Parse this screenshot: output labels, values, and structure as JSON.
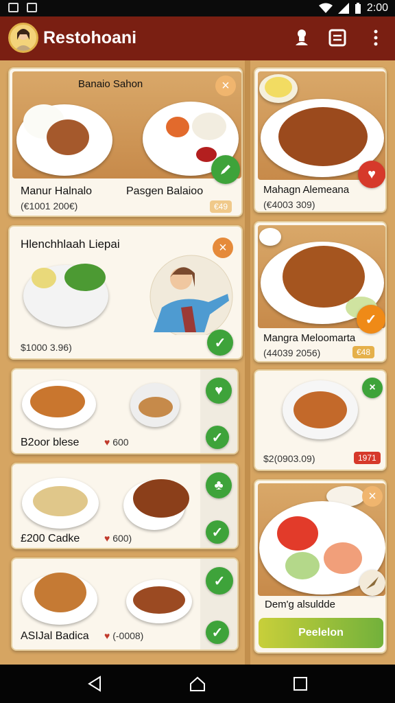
{
  "status": {
    "time": "2:00"
  },
  "app": {
    "title": "Restohoani"
  },
  "cards": {
    "c1": {
      "caption": "Banaio Sahon",
      "title_left": "Manur Halnalo",
      "title_right": "Pasgen Balaioo",
      "price": "(€1001 200€)",
      "tag": "€49"
    },
    "c2": {
      "caption": "Hlenchhlaah Liepai",
      "price": "$1000 3.96)"
    },
    "c3": {
      "title": "B2oor blese",
      "price": "600"
    },
    "c4": {
      "title": "£200 Cadke",
      "price": "600)"
    },
    "c5": {
      "title": "ASIJal Badica",
      "price": "(-0008)"
    },
    "r1": {
      "title": "Mahagn Alemeana",
      "price": "(€4003 309)"
    },
    "r2": {
      "title": "Mangra Meloomarta",
      "price": "(44039 2056)",
      "tag": "€48"
    },
    "r3": {
      "price": "$2(0903.09)",
      "tag": "1971"
    },
    "r4": {
      "title": "Dem'g alsuldde"
    }
  },
  "cta": {
    "label": "Peelelon"
  },
  "colors": {
    "appbar": "#7a1f12",
    "background": "#d6a562",
    "green": "#3ea33a",
    "orange": "#ef8a17"
  }
}
